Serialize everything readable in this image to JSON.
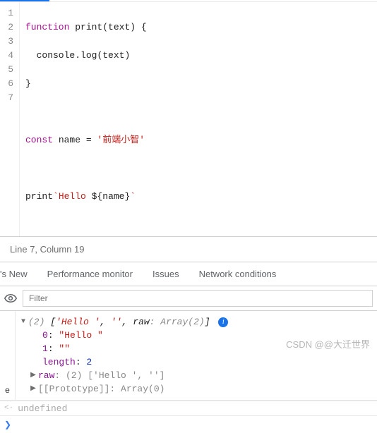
{
  "editor": {
    "lines": [
      "1",
      "2",
      "3",
      "4",
      "5",
      "6",
      "7"
    ],
    "code": {
      "l1": {
        "kw": "function",
        "fn": " print",
        "args": "(text)",
        "brace": " {"
      },
      "l2": {
        "obj": "  console",
        "dot": ".",
        "method": "log",
        "args": "(text)"
      },
      "l3": "}",
      "l5": {
        "kw": "const",
        "name": " name ",
        "eq": "=",
        "sp": " ",
        "str": "'前端小智'"
      },
      "l7": {
        "fn": "print",
        "tick1": "`",
        "str1": "Hello ",
        "dollar": "$",
        "brace1": "{",
        "var": "name",
        "brace2": "}",
        "tick2": "`"
      }
    }
  },
  "status": {
    "text": "Line 7, Column 19"
  },
  "tabs": {
    "whatsnew": "'s New",
    "perf": "Performance monitor",
    "issues": "Issues",
    "network": "Network conditions"
  },
  "toolbar": {
    "filter_placeholder": "Filter"
  },
  "sidebar": {
    "e": "e"
  },
  "console": {
    "summary": {
      "count": "(2)",
      "open": " [",
      "s1": "'Hello '",
      "comma": ", ",
      "s2": "''",
      "raw_label": "raw",
      "raw_val": ": Array(2)",
      "close": "]"
    },
    "entries": {
      "k0": "0",
      "v0": "\"Hello \"",
      "k1": "1",
      "v1": "\"\"",
      "len_k": "length",
      "len_v": "2",
      "raw_k": "raw",
      "raw_sum": ": (2) ['Hello ', '']",
      "proto_k": "[[Prototype]]",
      "proto_v": ": Array(0)"
    },
    "result": "undefined"
  },
  "watermark": "CSDN @@大迁世界"
}
